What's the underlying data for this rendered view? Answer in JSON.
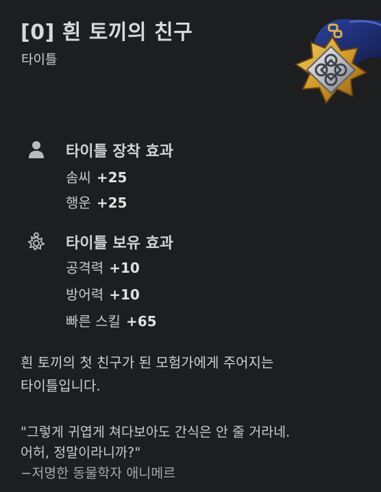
{
  "header": {
    "title": "[0] 흰 토끼의 친구",
    "subtitle": "타이틀"
  },
  "equip_effect": {
    "icon": "person-icon",
    "heading": "타이틀 장착 효과",
    "stats": [
      {
        "label": "솜씨",
        "value": "+25"
      },
      {
        "label": "행운",
        "value": "+25"
      }
    ]
  },
  "own_effect": {
    "icon": "medal-icon",
    "heading": "타이틀 보유 효과",
    "stats": [
      {
        "label": "공격력",
        "value": "+10"
      },
      {
        "label": "방어력",
        "value": "+10"
      },
      {
        "label": "빠른 스킬",
        "value": "+65"
      }
    ]
  },
  "description": {
    "line1": "흰 토끼의 첫 친구가 된 모험가에게 주어지는",
    "line2": "타이틀입니다."
  },
  "quote": {
    "line1": "\"그렇게 귀엽게 쳐다보아도 간식은 안 줄 거라네.",
    "line2": "어허, 정말이라니까?\"",
    "author": "−저명한 동물학자 애니메르"
  },
  "colors": {
    "background": "#1d1e1f",
    "text": "#d6d7d8",
    "emblem_gold": "#d9a531",
    "emblem_navy": "#1c2c6e",
    "emblem_silver": "#c9ccd0"
  }
}
